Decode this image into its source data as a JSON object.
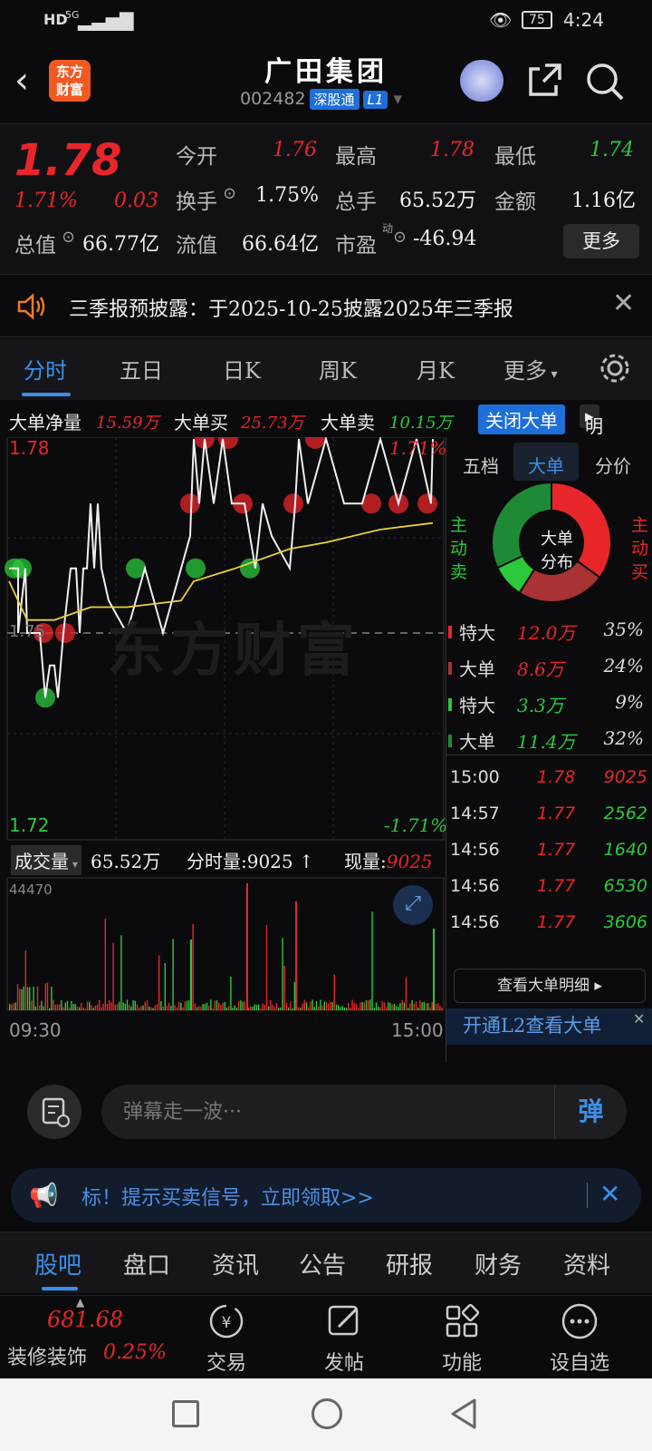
{
  "status": {
    "hd": "HD",
    "net": "5G",
    "battery": "75",
    "time": "4:24"
  },
  "header": {
    "logo_line1": "东方",
    "logo_line2": "财富",
    "title": "广田集团",
    "code": "002482",
    "tag1": "深股通",
    "tag2": "L1"
  },
  "quote": {
    "price": "1.78",
    "pct": "1.71%",
    "chg": "0.03",
    "open_label": "今开",
    "open": "1.76",
    "high_label": "最高",
    "high": "1.78",
    "low_label": "最低",
    "low": "1.74",
    "turnover_label": "换手",
    "turnover": "1.75%",
    "vol_label": "总手",
    "vol": "65.52万",
    "amount_label": "金额",
    "amount": "1.16亿",
    "mcap_label": "总值",
    "mcap": "66.77亿",
    "float_label": "流值",
    "float": "66.64亿",
    "pe_label": "市盈",
    "pe_sup": "动",
    "pe": "-46.94",
    "more": "更多"
  },
  "notice": {
    "text": "三季报预披露：于2025-10-25披露2025年三季报"
  },
  "tabs": [
    "分时",
    "五日",
    "日K",
    "周K",
    "月K",
    "更多"
  ],
  "bigorder": {
    "net_label": "大单净量",
    "net": "15.59万",
    "buy_label": "大单买",
    "buy": "25.73万",
    "sell_label": "大单卖",
    "sell": "10.15万",
    "close_btn": "关闭大单",
    "detail_btn": "明细"
  },
  "chart_labels": {
    "top_price": "1.78",
    "top_pct": "1.71%",
    "mid_price": "1.75",
    "bottom_price": "1.72",
    "bottom_pct": "-1.71%",
    "watermark": "东方财富",
    "vol_label": "成交量",
    "vol_total": "65.52万",
    "minute_vol": "分时量:9025",
    "now_vol_label": "现量:",
    "now_vol": "9025",
    "vol_axis": "44470",
    "t_start": "09:30",
    "t_end": "15:00"
  },
  "colors": {
    "up": "#e8262a",
    "down": "#2bc93c",
    "accent": "#1e6fd9",
    "avg_line": "#e8d23c"
  },
  "rpanel": {
    "tabs": [
      "五档",
      "大单",
      "分价"
    ],
    "donut_center1": "大单",
    "donut_center2": "分布",
    "side_left": "主动卖",
    "side_right": "主动买",
    "donut_pct": [
      35,
      24,
      9,
      32
    ],
    "legend": [
      {
        "label": "特大",
        "val": "12.0万",
        "pct": "35%",
        "color": "#e8262a"
      },
      {
        "label": "大单",
        "val": "8.6万",
        "pct": "24%",
        "color": "#a83234"
      },
      {
        "label": "特大",
        "val": "3.3万",
        "pct": "9%",
        "color": "#2bc93c"
      },
      {
        "label": "大单",
        "val": "11.4万",
        "pct": "32%",
        "color": "#1f8a36"
      }
    ],
    "ticks": [
      {
        "t": "15:00",
        "p": "1.78",
        "v": "9025",
        "vc": "red"
      },
      {
        "t": "14:57",
        "p": "1.77",
        "v": "2562",
        "vc": "green"
      },
      {
        "t": "14:56",
        "p": "1.77",
        "v": "1640",
        "vc": "green"
      },
      {
        "t": "14:56",
        "p": "1.77",
        "v": "6530",
        "vc": "green"
      },
      {
        "t": "14:56",
        "p": "1.77",
        "v": "3606",
        "vc": "green"
      }
    ],
    "detail_btn": "查看大单明细",
    "l2_promo": "开通L2查看大单"
  },
  "comment": {
    "placeholder": "弹幕走一波···",
    "danmu": "弹"
  },
  "promo": {
    "text": "标！提示买卖信号，立即领取>>"
  },
  "btabs": [
    "股吧",
    "盘口",
    "资讯",
    "公告",
    "研报",
    "财务",
    "资料"
  ],
  "toolbar": {
    "index_val": "681.68",
    "index_name": "装修装饰",
    "index_pct": "0.25%",
    "items": [
      "交易",
      "发帖",
      "功能",
      "设自选"
    ]
  }
}
